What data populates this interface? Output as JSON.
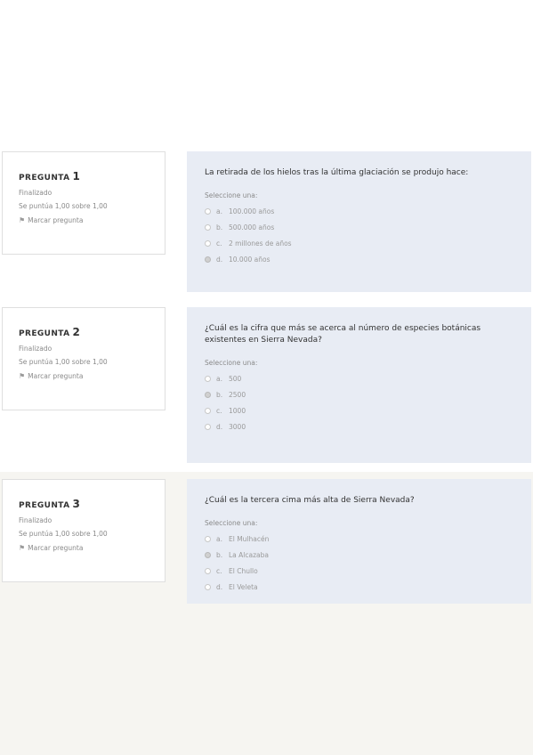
{
  "questions": [
    {
      "label": "PREGUNTA",
      "number": "1",
      "status": "Finalizado",
      "score": "Se puntúa 1,00 sobre 1,00",
      "flag_label": "Marcar pregunta",
      "text": "La retirada de los hielos tras la última glaciación se produjo hace:",
      "prompt": "Seleccione una:",
      "answers": [
        {
          "letter": "a.",
          "text": "100.000 años",
          "selected": false
        },
        {
          "letter": "b.",
          "text": "500.000 años",
          "selected": false
        },
        {
          "letter": "c.",
          "text": "2 millones de años",
          "selected": false
        },
        {
          "letter": "d.",
          "text": "10.000 años",
          "selected": true
        }
      ]
    },
    {
      "label": "PREGUNTA",
      "number": "2",
      "status": "Finalizado",
      "score": "Se puntúa 1,00 sobre 1,00",
      "flag_label": "Marcar pregunta",
      "text": "¿Cuál es la cifra que más se acerca al número de especies botánicas existentes en Sierra Nevada?",
      "prompt": "Seleccione una:",
      "answers": [
        {
          "letter": "a.",
          "text": "500",
          "selected": false
        },
        {
          "letter": "b.",
          "text": "2500",
          "selected": true
        },
        {
          "letter": "c.",
          "text": "1000",
          "selected": false
        },
        {
          "letter": "d.",
          "text": "3000",
          "selected": false
        }
      ]
    },
    {
      "label": "PREGUNTA",
      "number": "3",
      "status": "Finalizado",
      "score": "Se puntúa 1,00 sobre 1,00",
      "flag_label": "Marcar pregunta",
      "text": "¿Cuál es la tercera cima más alta de Sierra Nevada?",
      "prompt": "Seleccione una:",
      "answers": [
        {
          "letter": "a.",
          "text": "El Mulhacén",
          "selected": false
        },
        {
          "letter": "b.",
          "text": "La Alcazaba",
          "selected": true
        },
        {
          "letter": "c.",
          "text": "El Chullo",
          "selected": false
        },
        {
          "letter": "d.",
          "text": "El Veleta",
          "selected": false
        }
      ]
    }
  ],
  "icons": {
    "flag": "flag-icon",
    "radio": "radio-icon"
  }
}
